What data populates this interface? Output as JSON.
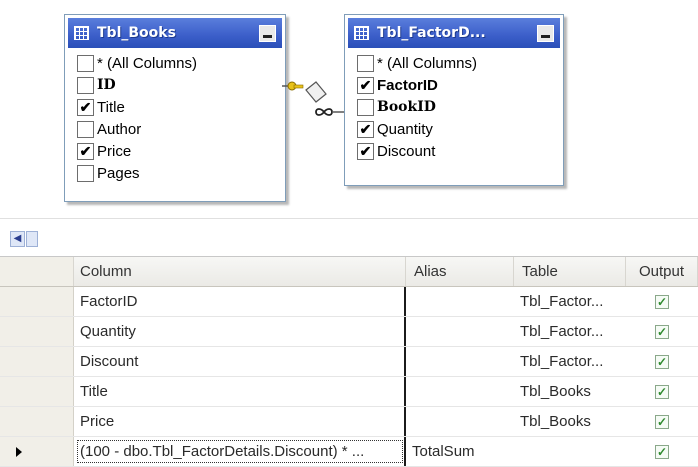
{
  "tables": [
    {
      "name": "Tbl_Books",
      "rows": [
        {
          "label": "* (All Columns)",
          "checked": false,
          "style": "normal"
        },
        {
          "label": "ID",
          "checked": false,
          "style": "key"
        },
        {
          "label": "Title",
          "checked": true,
          "style": "normal"
        },
        {
          "label": "Author",
          "checked": false,
          "style": "normal"
        },
        {
          "label": "Price",
          "checked": true,
          "style": "normal"
        },
        {
          "label": "Pages",
          "checked": false,
          "style": "normal"
        }
      ]
    },
    {
      "name": "Tbl_FactorD...",
      "rows": [
        {
          "label": "* (All Columns)",
          "checked": false,
          "style": "normal"
        },
        {
          "label": "FactorID",
          "checked": true,
          "style": "bold"
        },
        {
          "label": "BookID",
          "checked": false,
          "style": "key"
        },
        {
          "label": "Quantity",
          "checked": true,
          "style": "normal"
        },
        {
          "label": "Discount",
          "checked": true,
          "style": "normal"
        }
      ]
    }
  ],
  "grid": {
    "headers": {
      "column": "Column",
      "alias": "Alias",
      "table": "Table",
      "output": "Output"
    },
    "rows": [
      {
        "column": "FactorID",
        "alias": "",
        "table": "Tbl_Factor...",
        "output": true,
        "current": false
      },
      {
        "column": "Quantity",
        "alias": "",
        "table": "Tbl_Factor...",
        "output": true,
        "current": false
      },
      {
        "column": "Discount",
        "alias": "",
        "table": "Tbl_Factor...",
        "output": true,
        "current": false
      },
      {
        "column": "Title",
        "alias": "",
        "table": "Tbl_Books",
        "output": true,
        "current": false
      },
      {
        "column": "Price",
        "alias": "",
        "table": "Tbl_Books",
        "output": true,
        "current": false
      },
      {
        "column": "(100 - dbo.Tbl_FactorDetails.Discount) * ...",
        "alias": "TotalSum",
        "table": "",
        "output": true,
        "current": true
      }
    ]
  },
  "glyphs": {
    "check": "✔",
    "output_check": "✓",
    "scroll_left": "◀"
  },
  "colors": {
    "title_bar": "#3b5ec9",
    "output_check": "#2f8a2f"
  }
}
